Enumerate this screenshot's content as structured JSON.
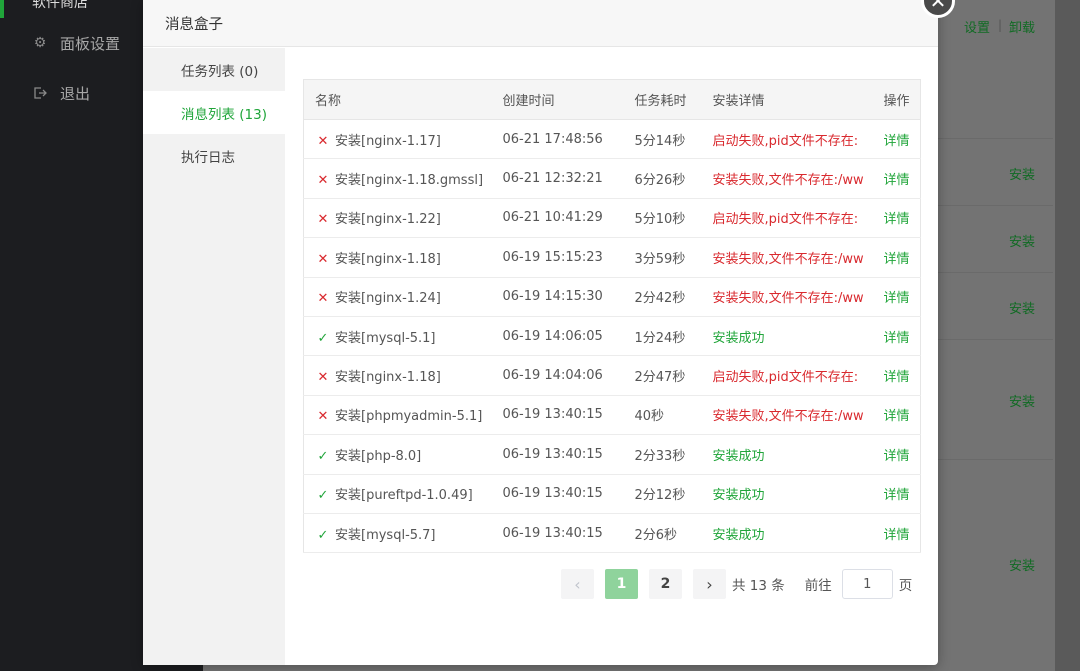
{
  "background": {
    "sidebar_top_fragment": "软件商店",
    "sidebar_items": [
      {
        "icon": "gear-icon",
        "label": "面板设置"
      },
      {
        "icon": "logout-icon",
        "label": "退出"
      }
    ],
    "top_links": {
      "settings": "设置",
      "separator": "|",
      "uninstall": "卸载"
    },
    "install_links": [
      "安装",
      "安装",
      "安装",
      "安装",
      "安装"
    ]
  },
  "modal": {
    "title": "消息盒子",
    "close_icon": "close-icon",
    "tabs": [
      {
        "label": "任务列表 (0)",
        "active": false
      },
      {
        "label": "消息列表 (13)",
        "active": true
      },
      {
        "label": "执行日志",
        "active": false
      }
    ],
    "table": {
      "headers": [
        "名称",
        "创建时间",
        "任务耗时",
        "安装详情",
        "操作"
      ],
      "rows": [
        {
          "status": "fail",
          "name": "安装[nginx-1.17]",
          "time": "06-21 17:48:56",
          "duration": "5分14秒",
          "detail": "启动失败,pid文件不存在:",
          "op": "详情"
        },
        {
          "status": "fail",
          "name": "安装[nginx-1.18.gmssl]",
          "time": "06-21 12:32:21",
          "duration": "6分26秒",
          "detail": "安装失败,文件不存在:/ww",
          "op": "详情"
        },
        {
          "status": "fail",
          "name": "安装[nginx-1.22]",
          "time": "06-21 10:41:29",
          "duration": "5分10秒",
          "detail": "启动失败,pid文件不存在:",
          "op": "详情"
        },
        {
          "status": "fail",
          "name": "安装[nginx-1.18]",
          "time": "06-19 15:15:23",
          "duration": "3分59秒",
          "detail": "安装失败,文件不存在:/ww",
          "op": "详情"
        },
        {
          "status": "fail",
          "name": "安装[nginx-1.24]",
          "time": "06-19 14:15:30",
          "duration": "2分42秒",
          "detail": "安装失败,文件不存在:/ww",
          "op": "详情"
        },
        {
          "status": "ok",
          "name": "安装[mysql-5.1]",
          "time": "06-19 14:06:05",
          "duration": "1分24秒",
          "detail": "安装成功",
          "op": "详情"
        },
        {
          "status": "fail",
          "name": "安装[nginx-1.18]",
          "time": "06-19 14:04:06",
          "duration": "2分47秒",
          "detail": "启动失败,pid文件不存在:",
          "op": "详情"
        },
        {
          "status": "fail",
          "name": "安装[phpmyadmin-5.1]",
          "time": "06-19 13:40:15",
          "duration": "40秒",
          "detail": "安装失败,文件不存在:/ww",
          "op": "详情"
        },
        {
          "status": "ok",
          "name": "安装[php-8.0]",
          "time": "06-19 13:40:15",
          "duration": "2分33秒",
          "detail": "安装成功",
          "op": "详情"
        },
        {
          "status": "ok",
          "name": "安装[pureftpd-1.0.49]",
          "time": "06-19 13:40:15",
          "duration": "2分12秒",
          "detail": "安装成功",
          "op": "详情"
        },
        {
          "status": "ok",
          "name": "安装[mysql-5.7]",
          "time": "06-19 13:40:15",
          "duration": "2分6秒",
          "detail": "安装成功",
          "op": "详情"
        }
      ]
    },
    "pagination": {
      "prev_icon": "chevron-left-icon",
      "pages": [
        "1",
        "2"
      ],
      "current_page": "1",
      "next_icon": "chevron-right-icon",
      "total_text": "共 13 条",
      "goto_label": "前往",
      "goto_value": "1",
      "page_suffix": "页"
    }
  },
  "colors": {
    "accent": "#20a53a",
    "error": "#d9292e"
  }
}
